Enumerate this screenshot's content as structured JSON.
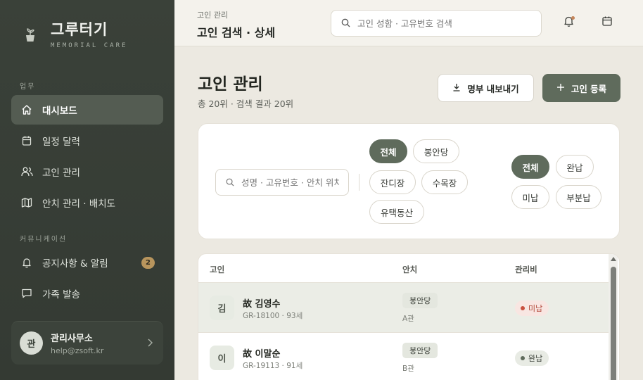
{
  "brand": {
    "name": "그루터기",
    "subtitle": "MEMORIAL CARE"
  },
  "sidebar": {
    "section_work": "업무",
    "section_comm": "커뮤니케이션",
    "items": [
      {
        "label": "대시보드",
        "icon": "home-icon",
        "active": true
      },
      {
        "label": "일정 달력",
        "icon": "calendar-icon"
      },
      {
        "label": "고인 관리",
        "icon": "users-icon"
      },
      {
        "label": "안치 관리 · 배치도",
        "icon": "map-icon"
      },
      {
        "label": "공지사항 & 알림",
        "icon": "bell-icon",
        "badge": "2"
      },
      {
        "label": "가족 발송",
        "icon": "message-icon"
      }
    ],
    "user": {
      "initial": "관",
      "name": "관리사무소",
      "email": "help@zsoft.kr"
    }
  },
  "header": {
    "breadcrumb": "고인 관리",
    "title": "고인 검색 · 상세",
    "search_placeholder": "고인 성함 · 고유번호 검색"
  },
  "main": {
    "title": "고인 관리",
    "subtitle": "총 20위 · 검색 결과 20위",
    "export_label": "명부 내보내기",
    "add_label": "고인 등록"
  },
  "filters": {
    "search_placeholder": "성명 · 고유번호 · 안치 위치",
    "location_chips": [
      "전체",
      "봉안당",
      "잔디장",
      "수목장",
      "유택동산"
    ],
    "payment_chips": [
      "전체",
      "완납",
      "미납",
      "부분납"
    ]
  },
  "table": {
    "headers": [
      "고인",
      "안치",
      "관리비"
    ],
    "rows": [
      {
        "initial": "김",
        "name": "故 김영수",
        "meta": "GR-18100 · 93세",
        "location": "봉안당",
        "location_sub": "A관",
        "status": "미납",
        "status_type": "unpaid"
      },
      {
        "initial": "이",
        "name": "故 이말순",
        "meta": "GR-19113 · 91세",
        "location": "봉안당",
        "location_sub": "B관",
        "status": "완납",
        "status_type": "paid"
      }
    ]
  },
  "colors": {
    "sidebar_bg": "#3a4139",
    "accent": "#5f6b5c",
    "badge": "#b8955d",
    "unpaid": "#c9503f"
  }
}
